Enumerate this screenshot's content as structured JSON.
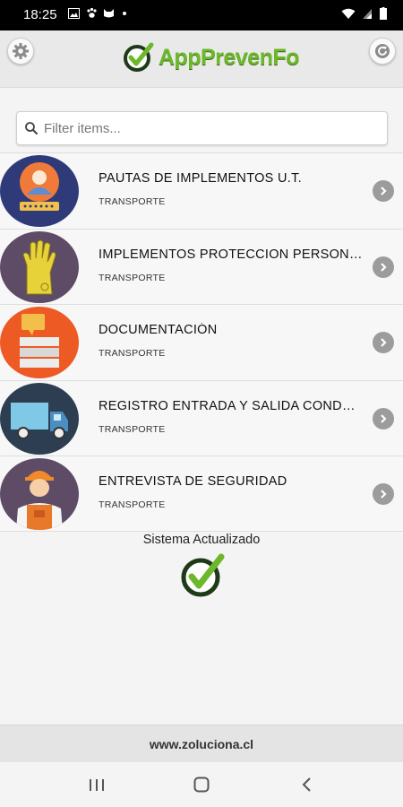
{
  "status_bar": {
    "time": "18:25",
    "notification_icons": [
      "image-icon",
      "paw-icon",
      "cat-icon",
      "dot-icon"
    ],
    "system_icons": [
      "wifi-icon",
      "signal-icon",
      "signal-icon",
      "battery-icon"
    ]
  },
  "header": {
    "logo_text": "AppPrevenFo",
    "left_button_icon": "gear-icon",
    "right_button_icon": "refresh-icon"
  },
  "search": {
    "placeholder": "Filter items..."
  },
  "items": [
    {
      "title": "PAUTAS DE IMPLEMENTOS U.T.",
      "subtitle": "TRANSPORTE",
      "icon": "user-id-card-icon"
    },
    {
      "title": "IMPLEMENTOS PROTECCION PERSONAL",
      "subtitle": "TRANSPORTE",
      "icon": "glove-icon"
    },
    {
      "title": "DOCUMENTACIÓN",
      "subtitle": "TRANSPORTE",
      "icon": "documents-icon"
    },
    {
      "title": "REGISTRO ENTRADA Y SALIDA CONDUCTORES",
      "subtitle": "TRANSPORTE",
      "icon": "truck-icon"
    },
    {
      "title": "ENTREVISTA DE SEGURIDAD",
      "subtitle": "TRANSPORTE",
      "icon": "worker-icon"
    }
  ],
  "status": {
    "text": "Sistema Actualizado",
    "icon": "check-circle-icon"
  },
  "footer": {
    "text": "www.zoluciona.cl"
  },
  "colors": {
    "brand_green": "#6cb82a",
    "item_bg": "#f7f7f7",
    "chevron_gray": "#9c9c9c"
  }
}
